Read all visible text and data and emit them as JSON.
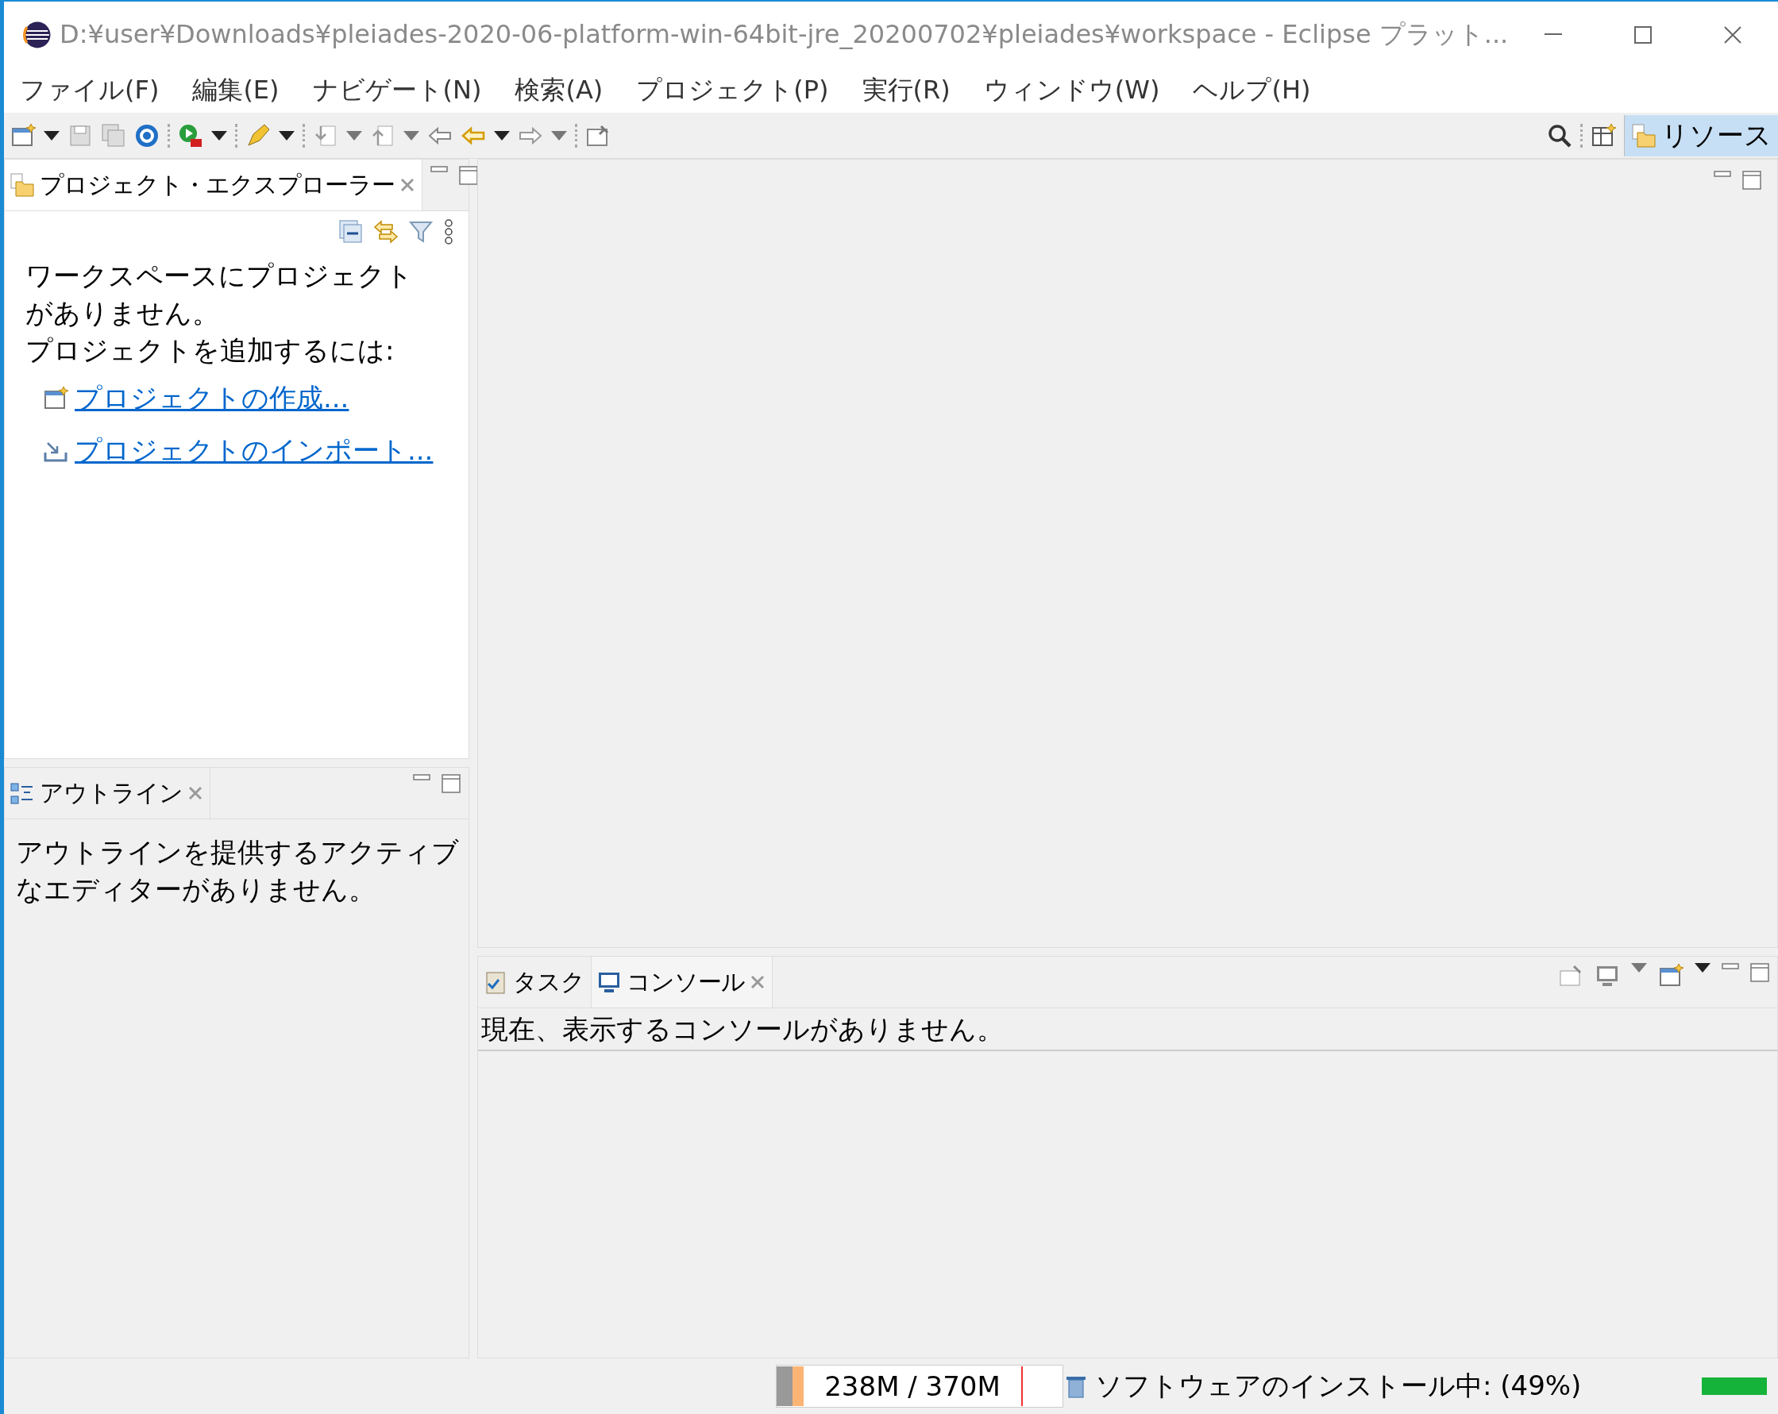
{
  "window": {
    "title": "D:¥user¥Downloads¥pleiades-2020-06-platform-win-64bit-jre_20200702¥pleiades¥workspace - Eclipse プラット..."
  },
  "menu": [
    "ファイル(F)",
    "編集(E)",
    "ナビゲート(N)",
    "検索(A)",
    "プロジェクト(P)",
    "実行(R)",
    "ウィンドウ(W)",
    "ヘルプ(H)"
  ],
  "perspectives": [
    {
      "label": "リソース",
      "selected": true
    }
  ],
  "project_explorer": {
    "tab": {
      "label": "プロジェクト・エクスプローラー",
      "selected": true
    },
    "message": "ワークスペースにプロジェクトがありません。",
    "prompt": "プロジェクトを追加するには:",
    "links": [
      {
        "kind": "create",
        "label": "プロジェクトの作成..."
      },
      {
        "kind": "import",
        "label": "プロジェクトのインポート..."
      }
    ]
  },
  "outline": {
    "tab": {
      "label": "アウトライン",
      "selected": true
    },
    "message": "アウトラインを提供するアクティブなエディターがありません。"
  },
  "bottom_panel": {
    "tabs": [
      {
        "kind": "tasks",
        "label": "タスク",
        "selected": false
      },
      {
        "kind": "console",
        "label": "コンソール",
        "selected": true
      }
    ],
    "message": "現在、表示するコンソールがありません。"
  },
  "status_bar": {
    "heap": "238M / 370M",
    "task": "ソフトウェアのインストール中: (49%)",
    "progress": {
      "level": 1
    }
  }
}
